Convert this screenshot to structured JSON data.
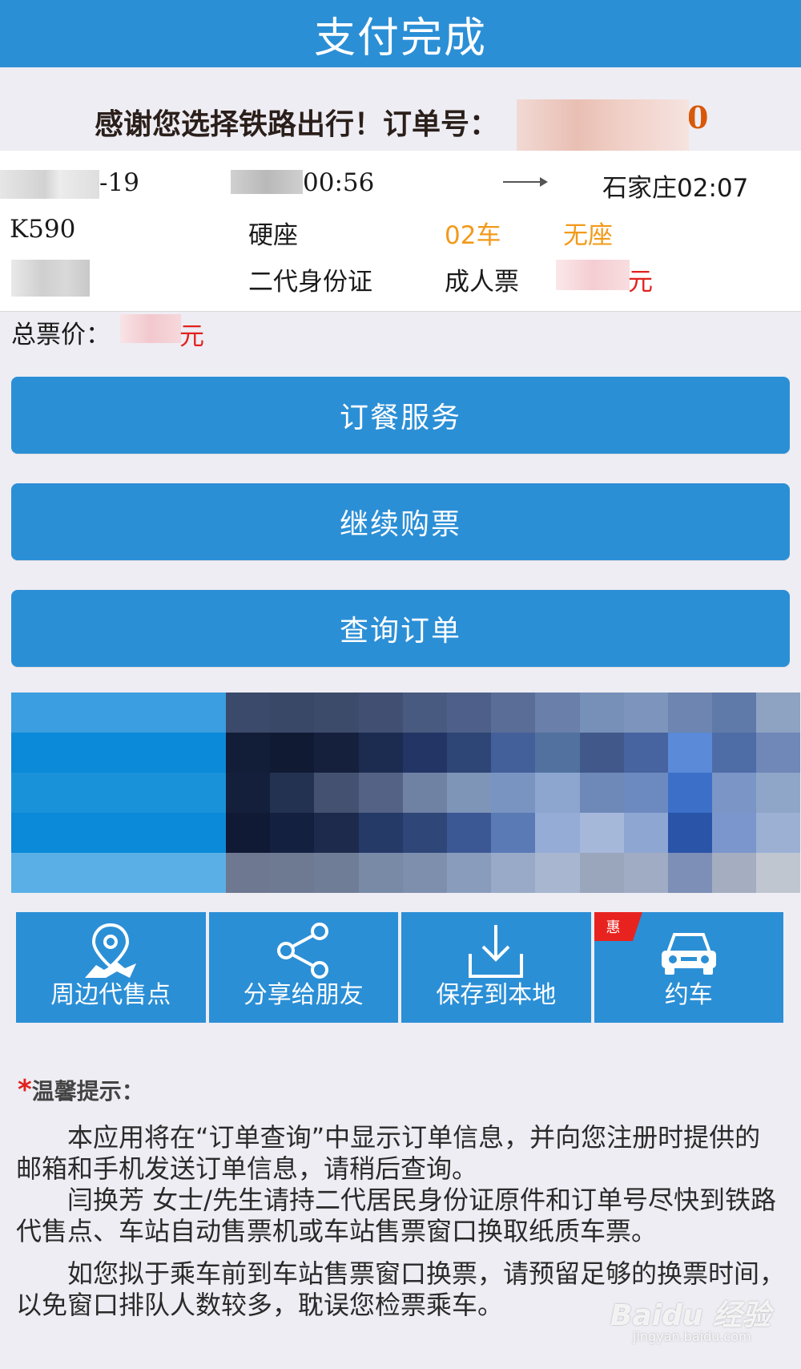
{
  "header": {
    "title": "支付完成"
  },
  "thanks": {
    "text": "感谢您选择铁路出行！订单号：",
    "order_tail": "0"
  },
  "trip": {
    "date_tail": "-19",
    "depart_time_tail": "00:56",
    "arrive": "石家庄02:07",
    "train_no": "K590",
    "seat_class": "硬座",
    "car": "02车",
    "seat": "无座",
    "id_type": "二代身份证",
    "ticket_type": "成人票",
    "price_unit": "元"
  },
  "total": {
    "label": "总票价：",
    "unit": "元"
  },
  "buttons": {
    "meal": "订餐服务",
    "continue": "继续购票",
    "query": "查询订单"
  },
  "tiles": [
    {
      "label": "周边代售点",
      "icon": "map-pin-icon"
    },
    {
      "label": "分享给朋友",
      "icon": "share-icon"
    },
    {
      "label": "保存到本地",
      "icon": "download-icon"
    },
    {
      "label": "约车",
      "icon": "car-icon",
      "badge": "惠"
    }
  ],
  "tips": {
    "star": "*",
    "title": "温馨提示：",
    "p1": "　　本应用将在“订单查询”中显示订单信息，并向您注册时提供的邮箱和手机发送订单信息，请稍后查询。",
    "p2": "　　闫换芳 女士/先生请持二代居民身份证原件和订单号尽快到铁路代售点、车站自动售票机或车站售票窗口换取纸质车票。",
    "p3": "　　如您拟于乘车前到车站售票窗口换票，请预留足够的换票时间，以免窗口排队人数较多，耽误您检票乘车。"
  },
  "watermark": {
    "main": "Baidu 经验",
    "sub": "jingyan.baidu.com"
  },
  "colors": {
    "primary": "#2b8fd6",
    "accent_orange": "#f29a1a",
    "price_red": "#e0231f",
    "order_orange": "#d8580a"
  }
}
